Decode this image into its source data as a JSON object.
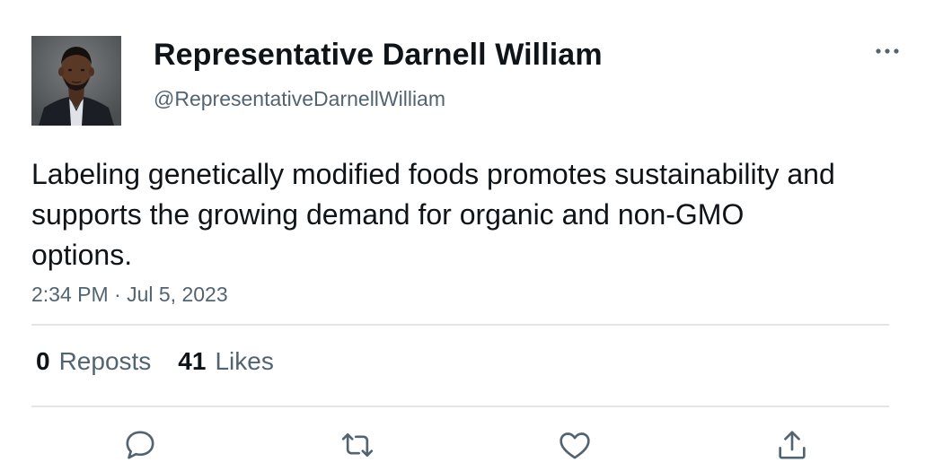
{
  "tweet": {
    "author": {
      "display_name": "Representative Darnell William",
      "handle": "@RepresentativeDarnellWilliam"
    },
    "text": "Labeling genetically modified foods promotes sustainability and supports the growing demand for organic and non-GMO options.",
    "timestamp": "2:34 PM · Jul 5, 2023",
    "stats": {
      "reposts_count": "0",
      "reposts_label": "Reposts",
      "likes_count": "41",
      "likes_label": "Likes"
    }
  },
  "icons": {
    "more": "more-horizontal-icon",
    "reply": "reply-icon",
    "repost": "repost-icon",
    "like": "heart-icon",
    "share": "share-icon"
  },
  "colors": {
    "text_primary": "#0f1419",
    "text_secondary": "#536471",
    "divider": "#e1e5e8"
  }
}
